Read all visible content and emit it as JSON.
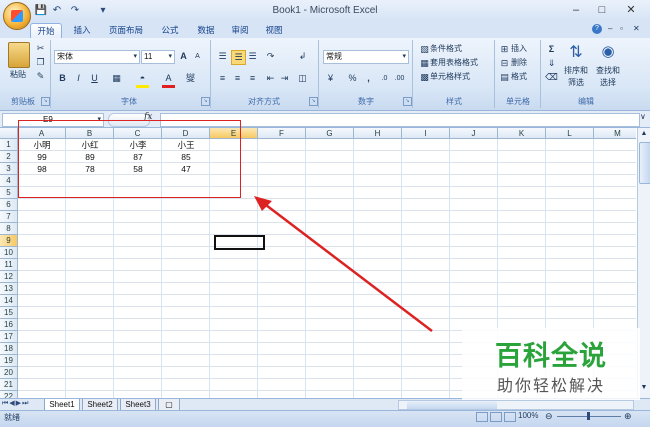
{
  "window": {
    "title": "Book1 - Microsoft Excel",
    "quick_access": [
      "save-icon",
      "undo-icon",
      "redo-icon",
      "customize-icon"
    ]
  },
  "tabs": [
    "开始",
    "插入",
    "页面布局",
    "公式",
    "数据",
    "审阅",
    "视图"
  ],
  "active_tab": "开始",
  "ribbon": {
    "clipboard": {
      "paste_label": "粘贴",
      "group_label": "剪贴板"
    },
    "font": {
      "font_name": "宋体",
      "font_size": "11",
      "group_label": "字体",
      "bold": "B",
      "italic": "I",
      "underline": "U",
      "grow": "A",
      "shrink": "A",
      "fontcolor": "A",
      "phonetic": "燮"
    },
    "alignment": {
      "group_label": "对齐方式"
    },
    "number": {
      "format": "常规",
      "group_label": "数字",
      "percent": "%",
      "comma": ","
    },
    "styles": {
      "conditional": "条件格式",
      "table": "套用表格格式",
      "cell": "单元格样式",
      "group_label": "样式"
    },
    "cells": {
      "insert": "插入",
      "delete": "删除",
      "format": "格式",
      "group_label": "单元格"
    },
    "editing": {
      "sort_filter_1": "排序和",
      "sort_filter_2": "筛选",
      "find_1": "查找和",
      "find_2": "选择",
      "group_label": "编辑"
    }
  },
  "formula_bar": {
    "name_box": "E9",
    "fx": "fx",
    "value": ""
  },
  "columns": [
    "A",
    "B",
    "C",
    "D",
    "E",
    "F",
    "G",
    "H",
    "I",
    "J",
    "K",
    "L",
    "M"
  ],
  "rows": [
    "1",
    "2",
    "3",
    "4",
    "5",
    "6",
    "7",
    "8",
    "9",
    "10",
    "11",
    "12",
    "13",
    "14",
    "15",
    "16",
    "17",
    "18",
    "19",
    "20",
    "21",
    "22"
  ],
  "cells": [
    {
      "ref": "A1",
      "value": "小明"
    },
    {
      "ref": "B1",
      "value": "小红"
    },
    {
      "ref": "C1",
      "value": "小李"
    },
    {
      "ref": "D1",
      "value": "小王"
    },
    {
      "ref": "A2",
      "value": "99"
    },
    {
      "ref": "B2",
      "value": "89"
    },
    {
      "ref": "C2",
      "value": "87"
    },
    {
      "ref": "D2",
      "value": "85"
    },
    {
      "ref": "A3",
      "value": "98"
    },
    {
      "ref": "B3",
      "value": "78"
    },
    {
      "ref": "C3",
      "value": "58"
    },
    {
      "ref": "D3",
      "value": "47"
    }
  ],
  "active_cell": "E9",
  "sheets": [
    "Sheet1",
    "Sheet2",
    "Sheet3"
  ],
  "status": {
    "mode": "就绪",
    "zoom": "100%"
  },
  "watermark": {
    "title": "百科全说",
    "subtitle": "助你轻松解决"
  },
  "colors": {
    "annotation": "#dd2222",
    "watermark": "#2aa33a"
  }
}
